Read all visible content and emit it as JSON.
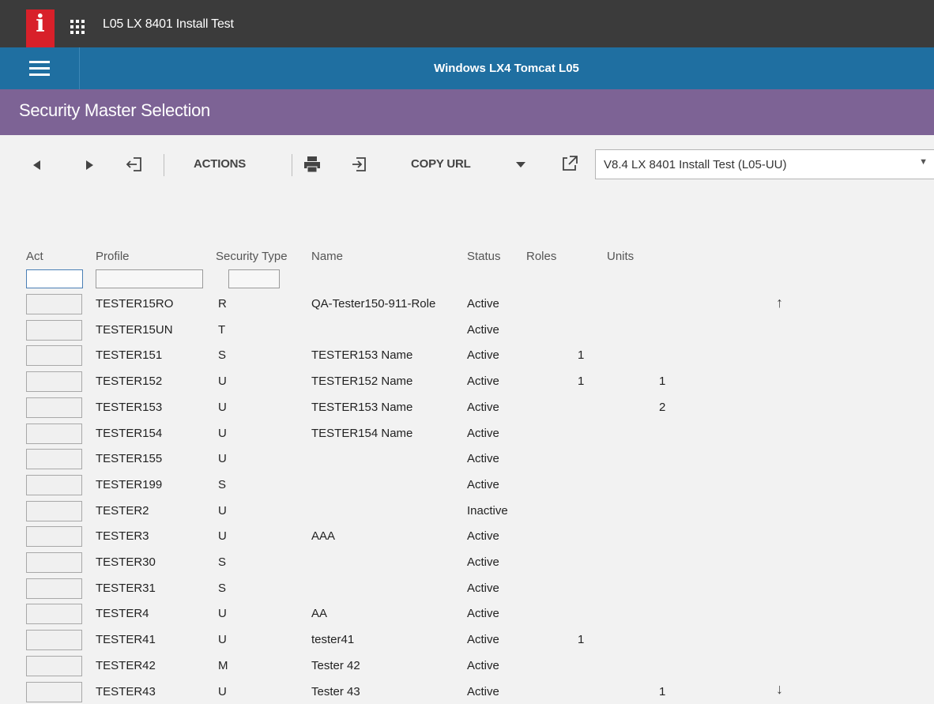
{
  "app": {
    "title": "L05 LX 8401 Install Test",
    "logo_letter": "i"
  },
  "environment": {
    "title": "Windows LX4 Tomcat L05"
  },
  "page": {
    "title": "Security Master Selection"
  },
  "toolbar": {
    "actions_label": "ACTIONS",
    "copy_url_label": "COPY URL",
    "version_selected": "V8.4 LX 8401 Install Test (L05-UU)"
  },
  "table": {
    "headers": {
      "act": "Act",
      "profile": "Profile",
      "security_type": "Security Type",
      "name": "Name",
      "status": "Status",
      "roles": "Roles",
      "units": "Units"
    },
    "rows": [
      {
        "profile": "TESTER15RO",
        "type": "R",
        "name": "QA-Tester150-911-Role",
        "status": "Active",
        "roles": "",
        "units": ""
      },
      {
        "profile": "TESTER15UN",
        "type": "T",
        "name": "",
        "status": "Active",
        "roles": "",
        "units": ""
      },
      {
        "profile": "TESTER151",
        "type": "S",
        "name": "TESTER153 Name",
        "status": "Active",
        "roles": "1",
        "units": ""
      },
      {
        "profile": "TESTER152",
        "type": "U",
        "name": "TESTER152 Name",
        "status": "Active",
        "roles": "1",
        "units": "1"
      },
      {
        "profile": "TESTER153",
        "type": "U",
        "name": "TESTER153 Name",
        "status": "Active",
        "roles": "",
        "units": "2"
      },
      {
        "profile": "TESTER154",
        "type": "U",
        "name": "TESTER154 Name",
        "status": "Active",
        "roles": "",
        "units": ""
      },
      {
        "profile": "TESTER155",
        "type": "U",
        "name": "",
        "status": "Active",
        "roles": "",
        "units": ""
      },
      {
        "profile": "TESTER199",
        "type": "S",
        "name": "",
        "status": "Active",
        "roles": "",
        "units": ""
      },
      {
        "profile": "TESTER2",
        "type": "U",
        "name": "",
        "status": "Inactive",
        "roles": "",
        "units": ""
      },
      {
        "profile": "TESTER3",
        "type": "U",
        "name": "AAA",
        "status": "Active",
        "roles": "",
        "units": ""
      },
      {
        "profile": "TESTER30",
        "type": "S",
        "name": "",
        "status": "Active",
        "roles": "",
        "units": ""
      },
      {
        "profile": "TESTER31",
        "type": "S",
        "name": "",
        "status": "Active",
        "roles": "",
        "units": ""
      },
      {
        "profile": "TESTER4",
        "type": "U",
        "name": "AA",
        "status": "Active",
        "roles": "",
        "units": ""
      },
      {
        "profile": "TESTER41",
        "type": "U",
        "name": "tester41",
        "status": "Active",
        "roles": "1",
        "units": ""
      },
      {
        "profile": "TESTER42",
        "type": "M",
        "name": "Tester 42",
        "status": "Active",
        "roles": "",
        "units": ""
      },
      {
        "profile": "TESTER43",
        "type": "U",
        "name": "Tester 43",
        "status": "Active",
        "roles": "",
        "units": "1"
      }
    ]
  },
  "icons": {
    "back": "arrow-left-icon",
    "forward": "arrow-right-icon",
    "exit": "exit-icon",
    "print": "print-icon",
    "export": "export-icon",
    "dropdown": "chevron-down-icon",
    "open_external": "open-external-icon",
    "scroll_up": "arrow-up-icon",
    "scroll_down": "arrow-down-icon"
  },
  "colors": {
    "appbar": "#3b3b3b",
    "logo": "#d8202a",
    "envbar": "#1f6fa1",
    "pagebar": "#7d6395"
  }
}
